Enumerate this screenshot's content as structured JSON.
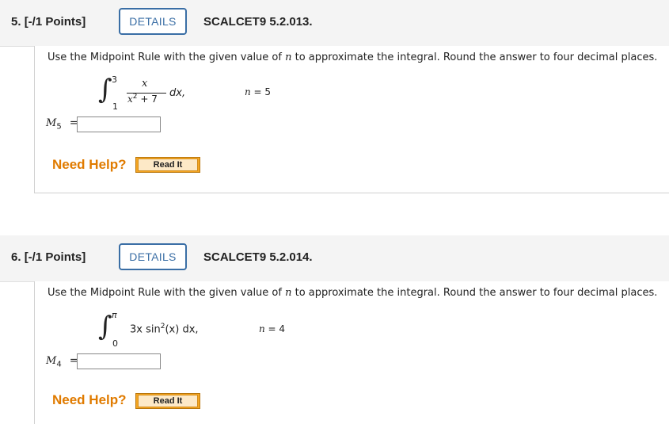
{
  "questions": [
    {
      "number": "5.",
      "points": "[-/1 Points]",
      "details_label": "DETAILS",
      "code": "SCALCET9 5.2.013.",
      "instruction_pre": "Use the Midpoint Rule with the given value of ",
      "instruction_var": "n",
      "instruction_post": " to approximate the integral. Round the answer to four decimal places.",
      "upper_limit": "3",
      "lower_limit": "1",
      "numerator": "x",
      "denominator_base": "x",
      "denominator_exp": "2",
      "denominator_rest": " + 7",
      "differential": "dx,",
      "n_label": "n",
      "n_value": " = 5",
      "answer_label": "M",
      "answer_sub": "5",
      "answer_eq": "=",
      "answer_value": "",
      "need_help": "Need Help?",
      "read_it": "Read It"
    },
    {
      "number": "6.",
      "points": "[-/1 Points]",
      "details_label": "DETAILS",
      "code": "SCALCET9 5.2.014.",
      "instruction_pre": "Use the Midpoint Rule with the given value of ",
      "instruction_var": "n",
      "instruction_post": " to approximate the integral. Round the answer to four decimal places.",
      "upper_limit": "π",
      "lower_limit": "0",
      "integrand_pre": "3x sin",
      "integrand_exp": "2",
      "integrand_post": "(x) dx,",
      "n_label": "n",
      "n_value": " = 4",
      "answer_label": "M",
      "answer_sub": "4",
      "answer_eq": "=",
      "answer_value": "",
      "need_help": "Need Help?",
      "read_it": "Read It"
    }
  ]
}
